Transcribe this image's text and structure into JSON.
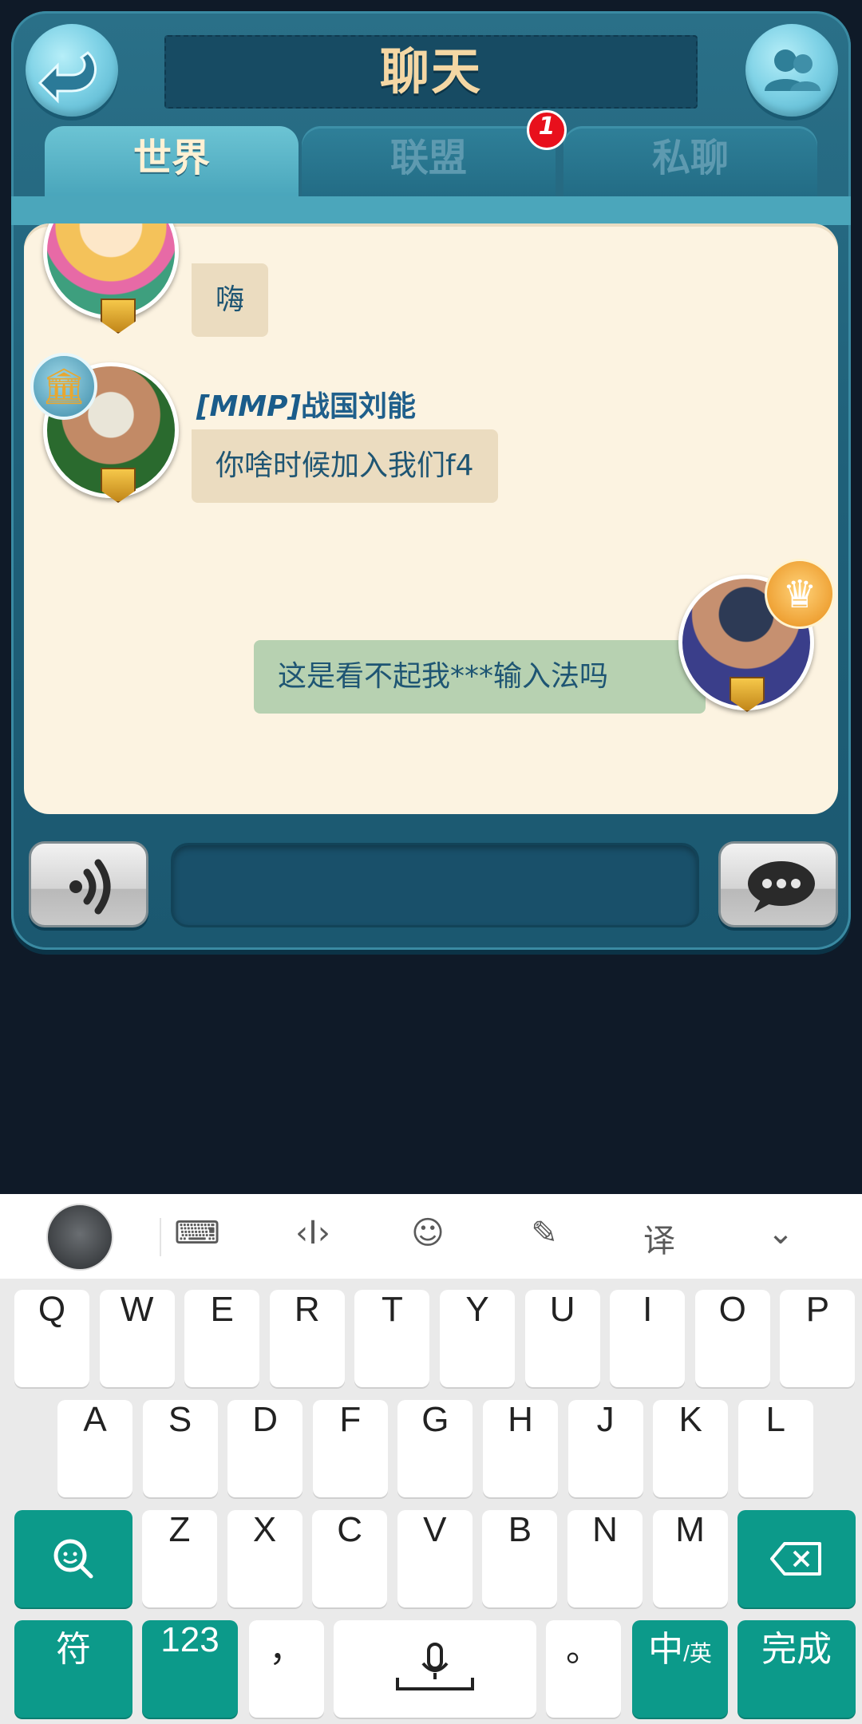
{
  "header": {
    "title": "聊天"
  },
  "tabs": [
    {
      "label": "世界",
      "active": true
    },
    {
      "label": "联盟",
      "active": false,
      "badge": "1"
    },
    {
      "label": "私聊",
      "active": false
    }
  ],
  "messages": [
    {
      "sender_tag": "",
      "sender_name": "",
      "text": "嗨",
      "direction": "in"
    },
    {
      "sender_tag": "[MMP]",
      "sender_name": "战国刘能",
      "text": "你啥时候加入我们f4",
      "direction": "in"
    },
    {
      "sender_tag": "",
      "sender_name": "",
      "text": "这是看不起我***输入法吗",
      "direction": "out"
    }
  ],
  "input": {
    "value": "",
    "placeholder": ""
  },
  "keyboard": {
    "toolbar_icons": [
      "keyboard-icon",
      "cursor-icon",
      "emoji-icon",
      "chat-quick-icon",
      "translate-icon",
      "collapse-icon"
    ],
    "toolbar_glyphs": [
      "⌨",
      "‹I›",
      "☺",
      "✎",
      "译",
      "⌄"
    ],
    "row1": [
      "Q",
      "W",
      "E",
      "R",
      "T",
      "Y",
      "U",
      "I",
      "O",
      "P"
    ],
    "row2": [
      "A",
      "S",
      "D",
      "F",
      "G",
      "H",
      "J",
      "K",
      "L"
    ],
    "row3": [
      "Z",
      "X",
      "C",
      "V",
      "B",
      "N",
      "M"
    ],
    "symbols_label": "符",
    "numbers_label": "123",
    "comma_label": "，",
    "period_label": "。",
    "lang_main": "中",
    "lang_sub": "/英",
    "done_label": "完成"
  },
  "colors": {
    "panel": "#1f6079",
    "chat_bg": "#fcf3e1",
    "bubble_in": "#ebdcc0",
    "bubble_out": "#b7d1b1",
    "keyboard_accent": "#0c9a8a",
    "badge": "#e8101c"
  }
}
